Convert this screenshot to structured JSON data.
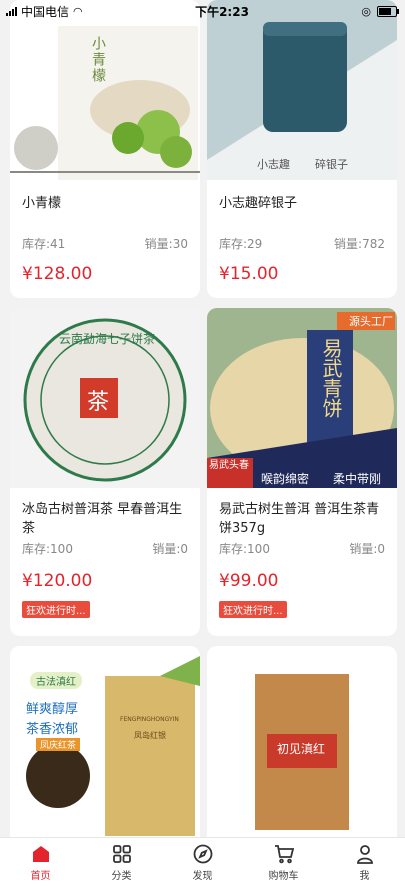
{
  "status": {
    "carrier": "中国电信",
    "time": "下午2:23"
  },
  "products": [
    {
      "title": "小青檬",
      "stock_label": "库存:41",
      "sales_label": "销量:30",
      "price": "¥128.00",
      "image_text": [
        "小青檬"
      ]
    },
    {
      "title": "小志趣碎银子",
      "stock_label": "库存:29",
      "sales_label": "销量:782",
      "price": "¥15.00",
      "image_text": [
        "小志趣",
        "碎银子"
      ]
    },
    {
      "title": "冰岛古树普洱茶 早春普洱生茶",
      "stock_label": "库存:100",
      "sales_label": "销量:0",
      "price": "¥120.00",
      "promo": "狂欢进行时...",
      "image_text": [
        "云南勐海七子饼茶",
        "茶"
      ]
    },
    {
      "title": "易武古树生普洱 普洱生茶青饼357g",
      "stock_label": "库存:100",
      "sales_label": "销量:0",
      "price": "¥99.00",
      "promo": "狂欢进行时...",
      "image_text": [
        "源头工厂",
        "易武青饼",
        "易武头春",
        "喉韵绵密",
        "柔中带刚"
      ]
    },
    {
      "image_text": [
        "古法滇红",
        "鲜爽醇厚",
        "茶香浓郁",
        "凤庆红茶",
        "FENGPINGHONGYIN",
        "凤岛红银"
      ]
    },
    {
      "image_text": [
        "初见滇红"
      ]
    }
  ],
  "tabs": [
    {
      "label": "首页",
      "icon": "home-icon",
      "active": true
    },
    {
      "label": "分类",
      "icon": "grid-icon",
      "active": false
    },
    {
      "label": "发现",
      "icon": "compass-icon",
      "active": false
    },
    {
      "label": "购物车",
      "icon": "cart-icon",
      "active": false
    },
    {
      "label": "我",
      "icon": "user-icon",
      "active": false
    }
  ],
  "colors": {
    "accent": "#e4242d",
    "promo": "#e84c3d"
  }
}
